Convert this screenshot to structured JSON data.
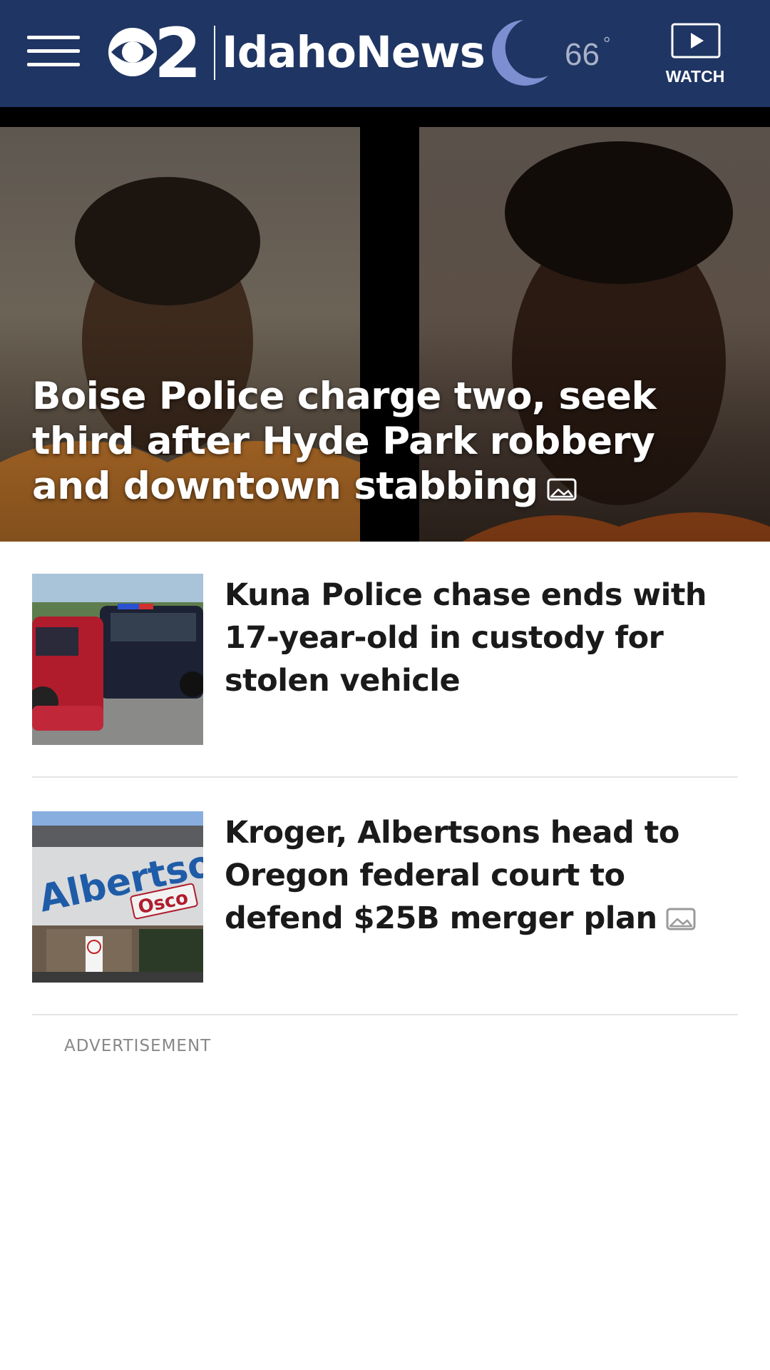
{
  "header": {
    "menu_icon": "hamburger-menu-icon",
    "logo": {
      "channel": "2",
      "brand": "IdahoNews"
    },
    "weather": {
      "icon": "moon-icon",
      "temperature": "66",
      "degree_symbol": "°"
    },
    "watch": {
      "icon": "play-icon",
      "label": "WATCH"
    },
    "colors": {
      "background": "#1f3563",
      "moon": "#7d8fd0"
    }
  },
  "hero": {
    "title": "Boise Police charge two, seek third after Hyde Park robbery and downtown stabbing",
    "badge_icon": "photo-gallery-icon"
  },
  "articles": [
    {
      "title": "Kuna Police chase ends with 17-year-old in custody for stolen vehicle",
      "thumbnail": "police-vehicles-scene"
    },
    {
      "title": "Kroger, Albertsons head to Oregon federal court to defend $25B merger plan",
      "thumbnail": "albertsons-storefront",
      "badge_icon": "photo-gallery-icon",
      "thumbnail_text": {
        "sign": "Albertsons",
        "pharmacy": "Osco"
      }
    }
  ],
  "advertisement": {
    "label": "ADVERTISEMENT"
  }
}
